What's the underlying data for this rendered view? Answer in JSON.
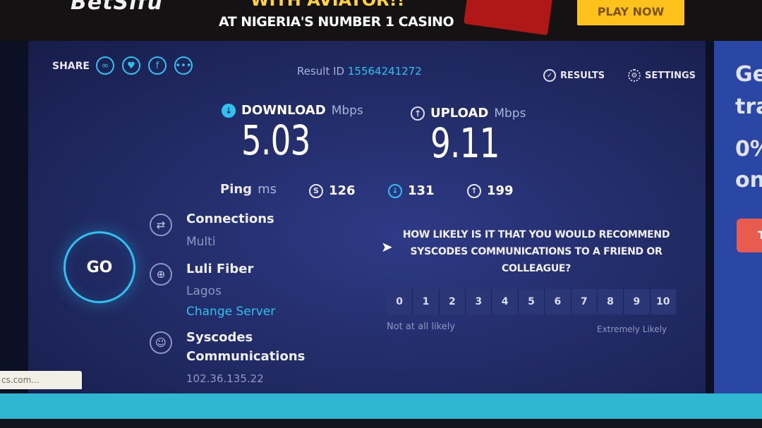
{
  "ad": {
    "brand": "BetSifu",
    "headline": "WITH AVIATOR!!",
    "subline": "AT NIGERIA'S NUMBER 1 CASINO",
    "cta": "PLAY NOW"
  },
  "toolbar": {
    "share_label": "SHARE",
    "share_icons": [
      "link-icon",
      "twitter-icon",
      "facebook-icon",
      "more-icon"
    ],
    "result_label": "Result ID",
    "result_id": "15564241272",
    "results_label": "RESULTS",
    "settings_label": "SETTINGS"
  },
  "download": {
    "label": "DOWNLOAD",
    "unit": "Mbps",
    "value": "5.03"
  },
  "upload": {
    "label": "UPLOAD",
    "unit": "Mbps",
    "value": "9.11"
  },
  "ping": {
    "label": "Ping",
    "unit": "ms",
    "idle": "126",
    "download": "131",
    "upload": "199"
  },
  "go_label": "GO",
  "connections": {
    "title": "Connections",
    "value": "Multi"
  },
  "server": {
    "name": "Luli Fiber",
    "location": "Lagos",
    "change_label": "Change Server"
  },
  "provider": {
    "name_line1": "Syscodes",
    "name_line2": "Communications",
    "ip": "102.36.135.22"
  },
  "survey": {
    "question": "HOW LIKELY IS IT THAT YOU WOULD RECOMMEND SYSCODES COMMUNICATIONS TO A FRIEND OR COLLEAGUE?",
    "scale": [
      "0",
      "1",
      "2",
      "3",
      "4",
      "5",
      "6",
      "7",
      "8",
      "9",
      "10"
    ],
    "low_label": "Not at all likely",
    "high_label": "Extremely Likely"
  },
  "sidebar": {
    "line1": "Ge",
    "line2": "tra",
    "line3": "0%",
    "line4": "on",
    "button": "Tr"
  },
  "status_url": "cs.com...",
  "colors": {
    "accent": "#2ec2f0",
    "panel": "#232d6a",
    "ad_cta": "#ffc21c"
  }
}
